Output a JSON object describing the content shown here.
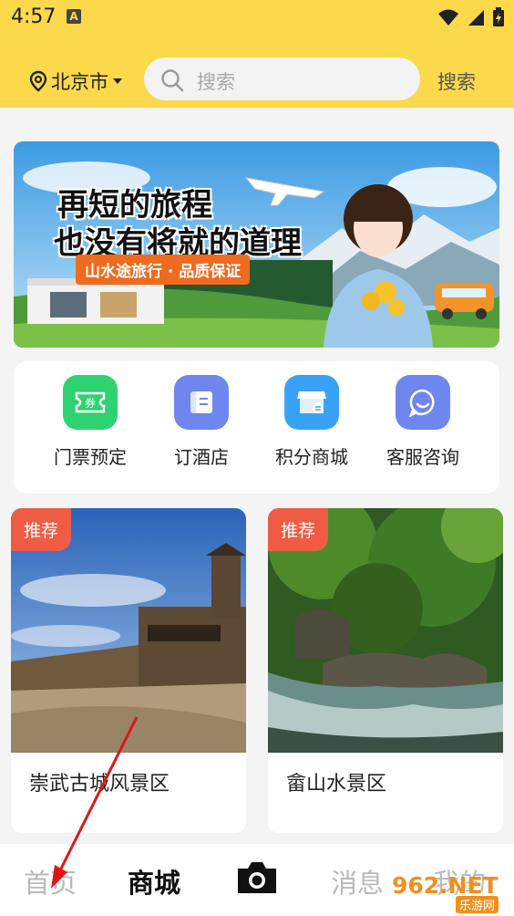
{
  "status_bar": {
    "time": "4:57",
    "notification_icon": "A"
  },
  "header": {
    "city": "北京市",
    "search_placeholder": "搜索",
    "search_button": "搜索"
  },
  "banner": {
    "title_line1": "再短的旅程",
    "title_line2": "也没有将就的道理",
    "tag": "山水途旅行 · 品质保证"
  },
  "quick_actions": [
    {
      "label": "门票预定",
      "icon": "ticket-icon",
      "color": "#2fd271"
    },
    {
      "label": "订酒店",
      "icon": "hotel-icon",
      "color": "#6f86ef"
    },
    {
      "label": "积分商城",
      "icon": "store-icon",
      "color": "#3aa2f6"
    },
    {
      "label": "客服咨询",
      "icon": "chat-icon",
      "color": "#6f86ef"
    }
  ],
  "cards": [
    {
      "badge": "推荐",
      "name": "崇武古城风景区"
    },
    {
      "badge": "推荐",
      "name": "畲山水景区"
    }
  ],
  "bottom_nav": {
    "home": "首页",
    "mall": "商城",
    "camera_icon": "camera-icon",
    "messages": "消息",
    "mine": "我的"
  },
  "watermark": {
    "text": "962.NET",
    "sub": "乐游网"
  },
  "colors": {
    "accent": "#fbd94a",
    "badge": "#ef5b43"
  }
}
